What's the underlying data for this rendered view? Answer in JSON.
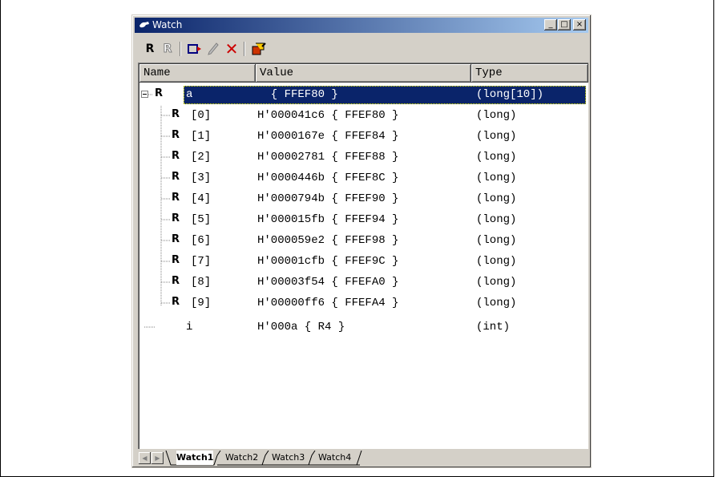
{
  "window": {
    "title": "Watch",
    "controls": [
      "_",
      "□",
      "×"
    ]
  },
  "toolbar": {
    "items": [
      {
        "name": "radix-hex-button",
        "glyph": "R"
      },
      {
        "name": "radix-dec-button",
        "glyph": "R"
      },
      {
        "name": "add-watch-button",
        "glyph": "▭"
      },
      {
        "name": "edit-value-button",
        "glyph": "/"
      },
      {
        "name": "delete-button",
        "glyph": "✕"
      },
      {
        "name": "refresh-button",
        "glyph": "⚙"
      }
    ]
  },
  "columns": {
    "name": "Name",
    "value": "Value",
    "type": "Type"
  },
  "rows": [
    {
      "name": "a",
      "value": "  { FFEF80 }",
      "type": "(long[10])"
    },
    {
      "name": "[0]",
      "value": "H'000041c6 { FFEF80 }",
      "type": "(long)"
    },
    {
      "name": "[1]",
      "value": "H'0000167e { FFEF84 }",
      "type": "(long)"
    },
    {
      "name": "[2]",
      "value": "H'00002781 { FFEF88 }",
      "type": "(long)"
    },
    {
      "name": "[3]",
      "value": "H'0000446b { FFEF8C }",
      "type": "(long)"
    },
    {
      "name": "[4]",
      "value": "H'0000794b { FFEF90 }",
      "type": "(long)"
    },
    {
      "name": "[5]",
      "value": "H'000015fb { FFEF94 }",
      "type": "(long)"
    },
    {
      "name": "[6]",
      "value": "H'000059e2 { FFEF98 }",
      "type": "(long)"
    },
    {
      "name": "[7]",
      "value": "H'00001cfb { FFEF9C }",
      "type": "(long)"
    },
    {
      "name": "[8]",
      "value": "H'00003f54 { FFEFA0 }",
      "type": "(long)"
    },
    {
      "name": "[9]",
      "value": "H'00000ff6 { FFEFA4 }",
      "type": "(long)"
    },
    {
      "name": "i",
      "value": "H'000a { R4 }",
      "type": "(int)"
    }
  ],
  "tabs": [
    "Watch1",
    "Watch2",
    "Watch3",
    "Watch4"
  ],
  "active_tab": "Watch1",
  "colors": {
    "titlebar_start": "#0a246a",
    "titlebar_end": "#a6caf0",
    "selection": "#0a246a"
  }
}
